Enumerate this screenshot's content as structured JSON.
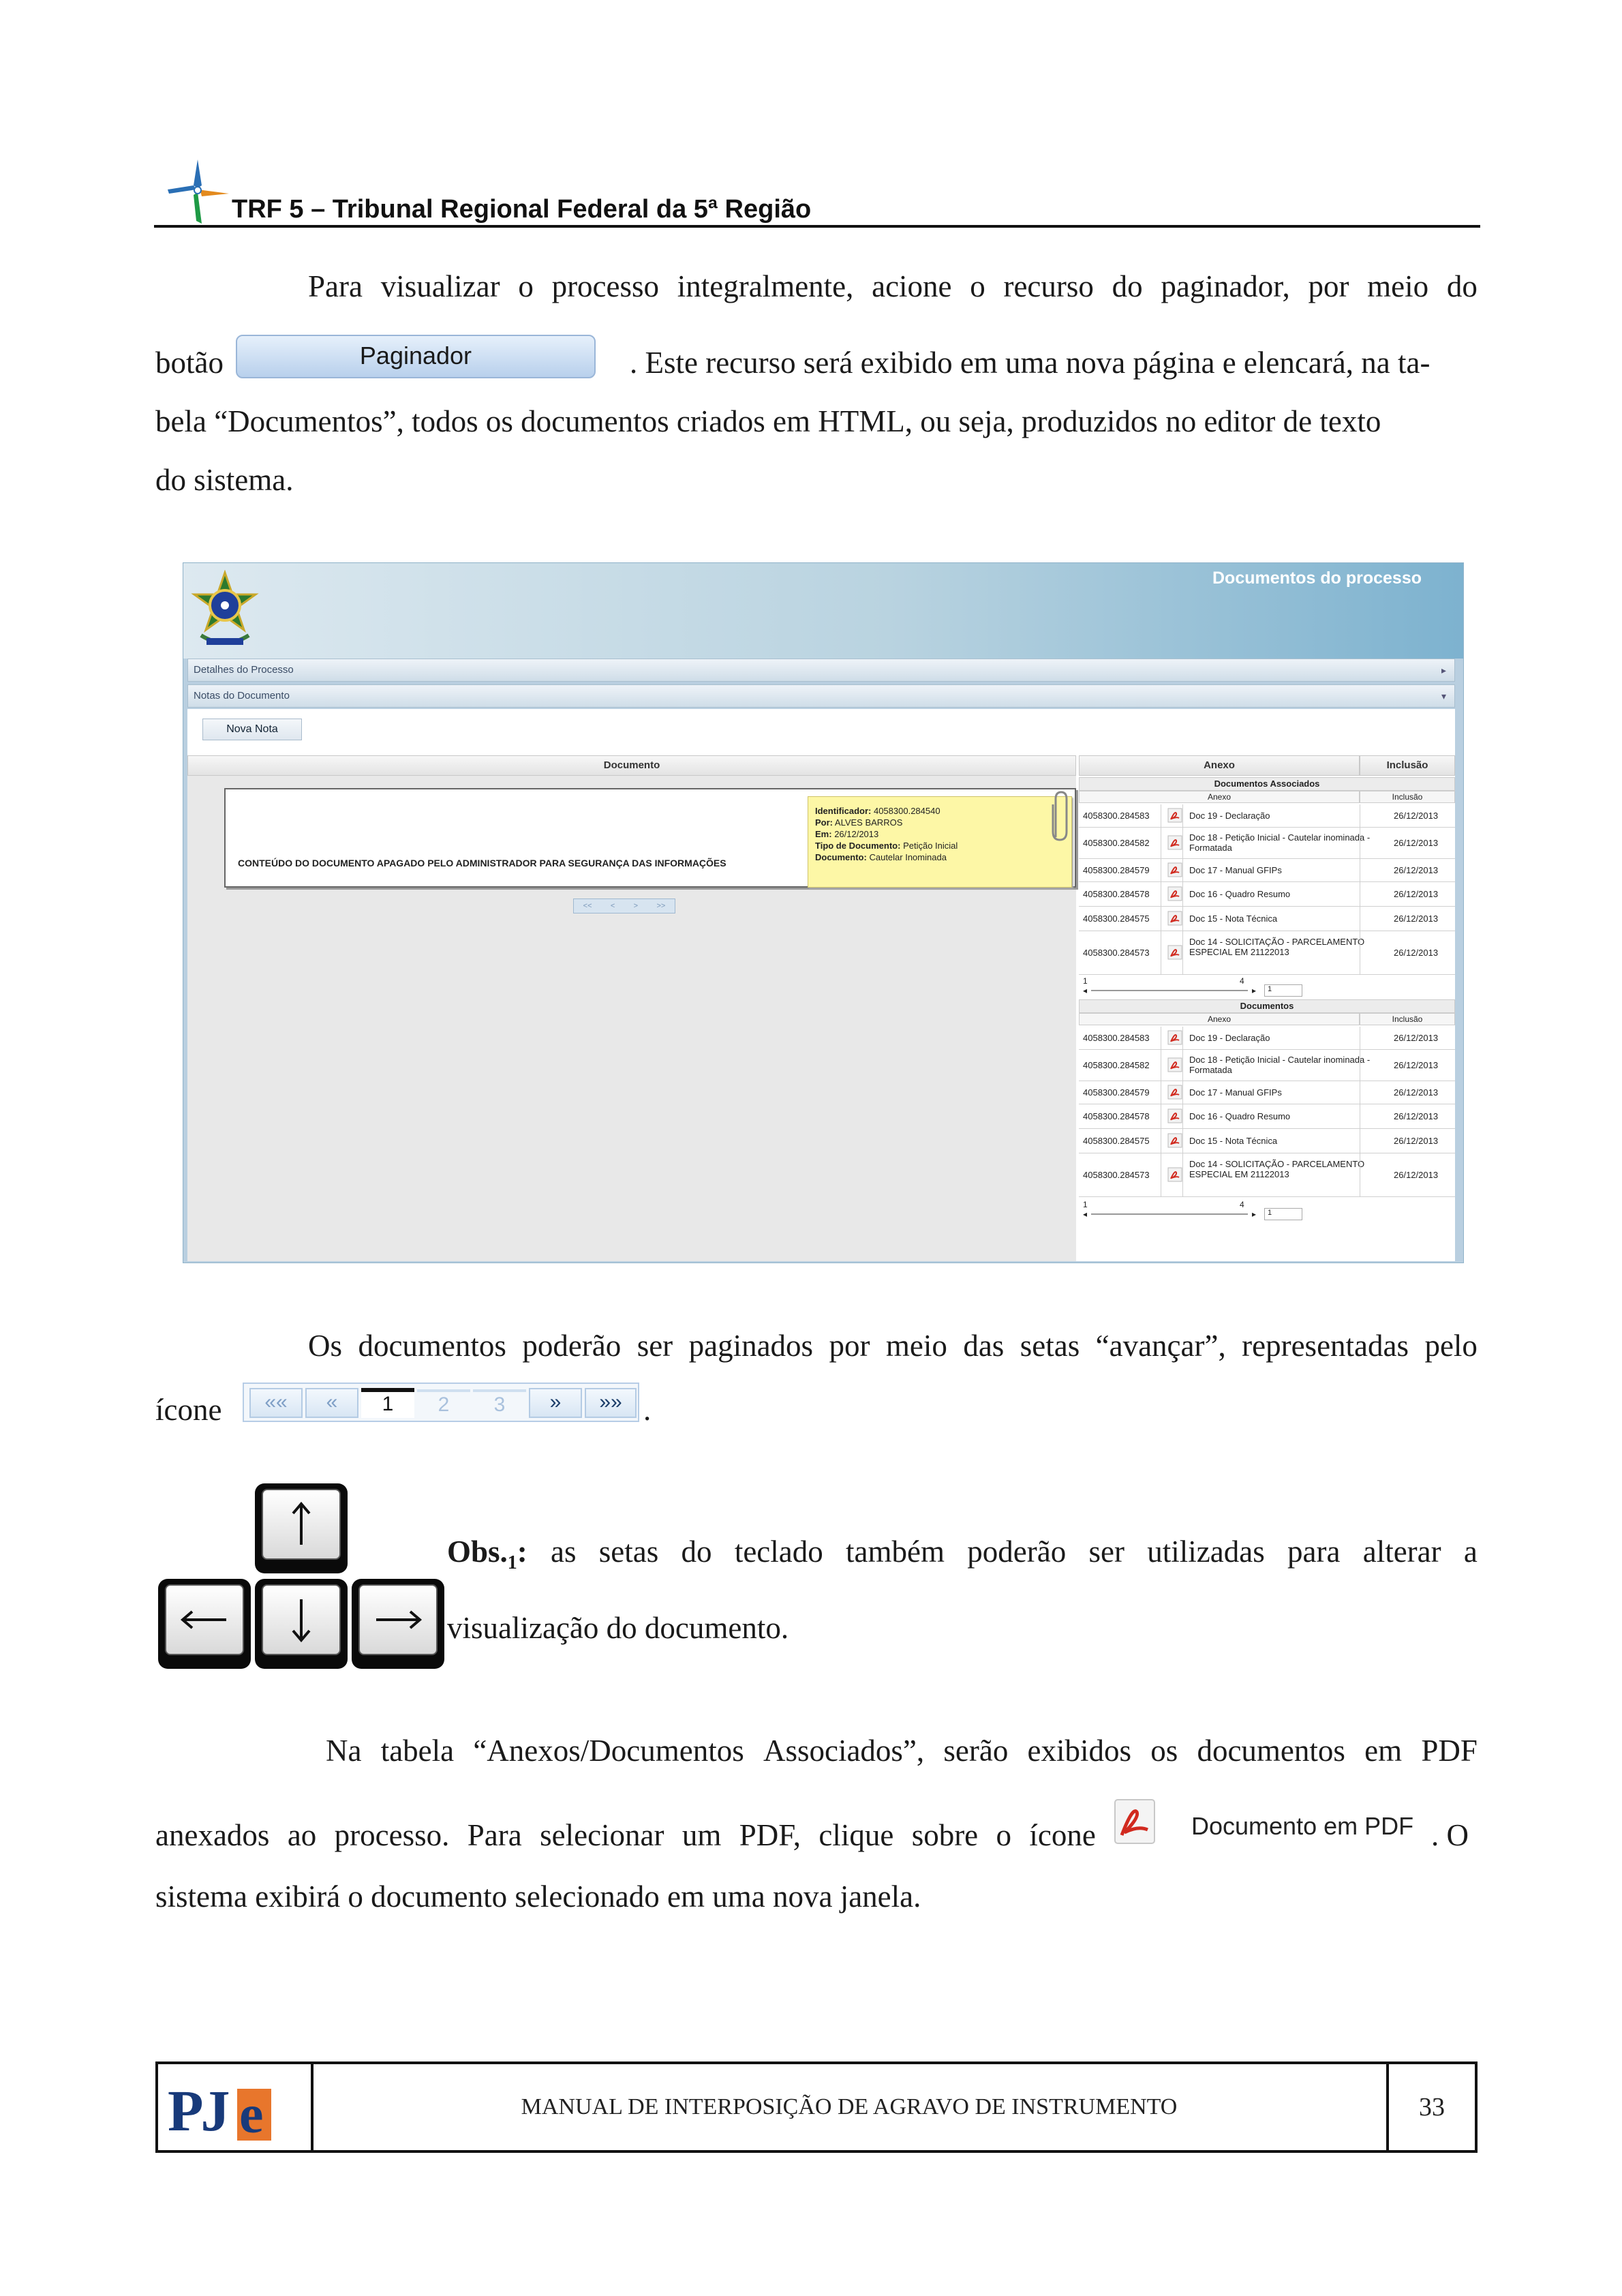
{
  "header": {
    "title": "TRF 5 – Tribunal Regional Federal da 5ª Região"
  },
  "para1": {
    "line1": [
      "Para",
      "visualizar",
      "o",
      "processo",
      "integralmente,",
      "acione",
      "o",
      "recurso",
      "do",
      "paginador,",
      "por",
      "meio",
      "do"
    ],
    "line2_prefix": "botão",
    "paginador_button": "Paginador",
    "line2_rest": ".   Este recurso será exibido em uma nova página e elencará, na ta-",
    "line3": "bela “Documentos”, todos os documentos criados em HTML, ou seja, produzidos no editor de texto",
    "line4": "do sistema."
  },
  "screenshot": {
    "title": "Documentos do processo",
    "bar1": "Detalhes do Processo",
    "bar2": "Notas do Documento",
    "nova_nota": "Nova Nota",
    "doc_header": "Documento",
    "doc_content": "CONTEÚDO DO DOCUMENTO APAGADO PELO ADMINISTRADOR PARA SEGURANÇA DAS INFORMAÇÕES",
    "note": {
      "identificador_label": "Identificador:",
      "identificador": "4058300.284540",
      "por_label": "Por:",
      "por": "ALVES BARROS",
      "em_label": "Em:",
      "em": "26/12/2013",
      "tipo_label": "Tipo de Documento:",
      "tipo": "Petição Inicial",
      "documento_label": "Documento:",
      "documento": "Cautelar Inominada"
    },
    "mini_pager": [
      "<<",
      "<",
      ">",
      ">>"
    ],
    "right_headers": {
      "anexo": "Anexo",
      "inclusao": "Inclusão"
    },
    "assoc_title": "Documentos Associados",
    "docs_title": "Documentos",
    "col_anexo": "Anexo",
    "col_inclusao": "Inclusão",
    "rows": [
      {
        "id": "4058300.284583",
        "name": "Doc 19 - Declaração",
        "date": "26/12/2013"
      },
      {
        "id": "4058300.284582",
        "name": "Doc 18 - Petição Inicial - Cautelar inominada - Formatada",
        "date": "26/12/2013"
      },
      {
        "id": "4058300.284579",
        "name": "Doc 17 - Manual GFIPs",
        "date": "26/12/2013"
      },
      {
        "id": "4058300.284578",
        "name": "Doc 16 - Quadro Resumo",
        "date": "26/12/2013"
      },
      {
        "id": "4058300.284575",
        "name": "Doc 15 - Nota Técnica",
        "date": "26/12/2013"
      },
      {
        "id": "4058300.284573",
        "name": "Doc 14 - SOLICITAÇÃO - PARCELAMENTO ESPECIAL EM 21122013",
        "date": "26/12/2013"
      }
    ],
    "footer_nums": {
      "left": "1",
      "mid": "4",
      "page": "1"
    }
  },
  "para2": {
    "line1": [
      "Os",
      "documentos",
      "poderão",
      "ser",
      "paginados",
      "por",
      "meio",
      "das",
      "setas",
      "“avançar”,",
      "representadas",
      "pelo"
    ],
    "line2_prefix": "ícone",
    "line2_suffix": "."
  },
  "pager_icon": {
    "first": "««",
    "prev": "«",
    "p1": "1",
    "p2": "2",
    "p3": "3",
    "next": "»",
    "last": "»»"
  },
  "obs": {
    "label": "Obs.",
    "sub": "1",
    "colon": ":",
    "line1": [
      "as",
      "setas",
      "do",
      "teclado",
      "também",
      "poderão",
      "ser",
      "utilizadas",
      "para",
      "alterar",
      "a"
    ],
    "line2": "visualização do documento."
  },
  "para3": {
    "line1": [
      "Na",
      "tabela",
      "“Anexos/Documentos",
      "Associados”,",
      "serão",
      "exibidos",
      "os",
      "documentos",
      "em",
      "PDF"
    ],
    "line2_words": [
      "anexados",
      "ao",
      "processo.",
      "Para",
      "selecionar",
      "um",
      "PDF,",
      "clique",
      "sobre",
      "o",
      "ícone"
    ],
    "pdf_label": "Documento em PDF",
    "line2_after": ".  O",
    "line3": "sistema exibirá o documento selecionado em uma nova janela."
  },
  "footer": {
    "logo_pj": "PJ",
    "logo_e": "e",
    "title": "MANUAL DE INTERPOSIÇÃO DE AGRAVO DE INSTRUMENTO",
    "page": "33"
  },
  "colors": {
    "accent_blue": "#183a7a",
    "pje_orange": "#e8762c",
    "note_yellow": "#fdf7a6"
  }
}
